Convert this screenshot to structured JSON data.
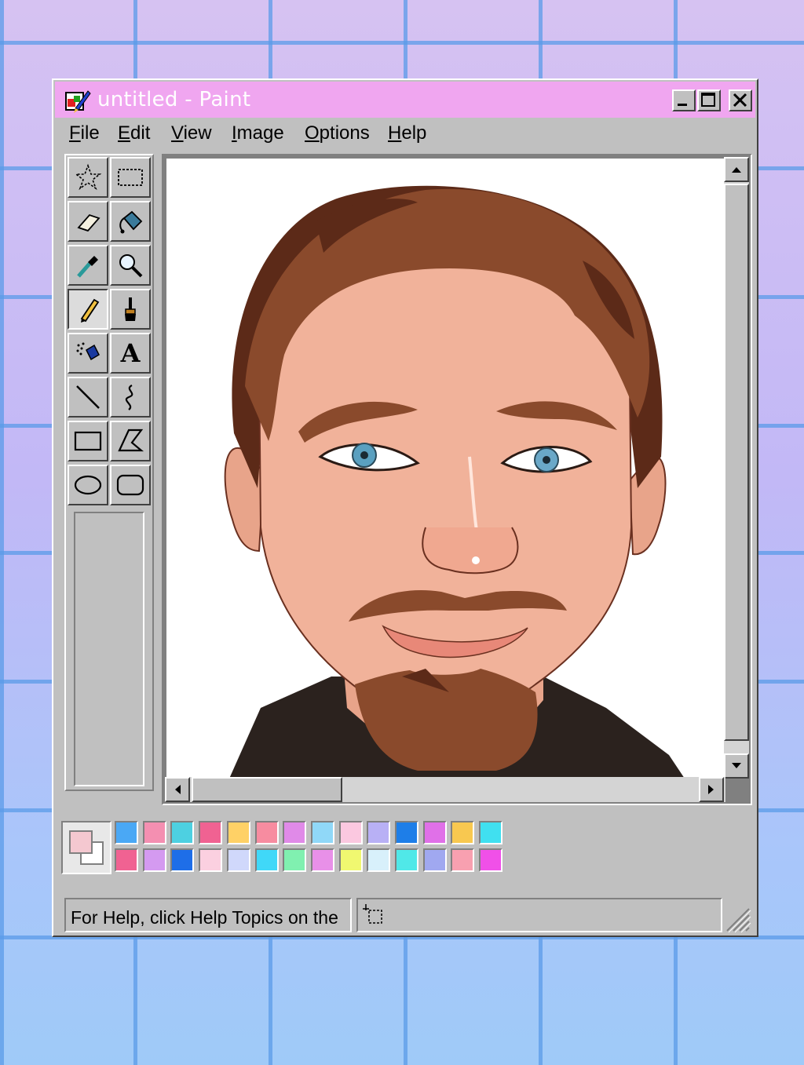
{
  "window": {
    "title": "untitled - Paint",
    "controls": [
      "minimize",
      "maximize",
      "close"
    ]
  },
  "menu": [
    {
      "label": "File",
      "accel": "F",
      "rest": "ile"
    },
    {
      "label": "Edit",
      "accel": "E",
      "rest": "dit"
    },
    {
      "label": "View",
      "accel": "V",
      "rest": "iew"
    },
    {
      "label": "Image",
      "accel": "I",
      "rest": "mage"
    },
    {
      "label": "Options",
      "accel": "O",
      "rest": "ptions"
    },
    {
      "label": "Help",
      "accel": "H",
      "rest": "elp"
    }
  ],
  "tools": [
    {
      "name": "free-form-select",
      "icon": "star-select-icon"
    },
    {
      "name": "rect-select",
      "icon": "dashed-rect-icon"
    },
    {
      "name": "eraser",
      "icon": "eraser-icon"
    },
    {
      "name": "fill",
      "icon": "paint-bucket-icon"
    },
    {
      "name": "pick-color",
      "icon": "eyedropper-icon"
    },
    {
      "name": "magnifier",
      "icon": "magnifier-icon"
    },
    {
      "name": "pencil",
      "icon": "pencil-icon",
      "active": true
    },
    {
      "name": "brush",
      "icon": "brush-icon"
    },
    {
      "name": "airbrush",
      "icon": "airbrush-icon"
    },
    {
      "name": "text",
      "icon": "text-icon",
      "glyph": "A"
    },
    {
      "name": "line",
      "icon": "line-icon"
    },
    {
      "name": "curve",
      "icon": "curve-icon"
    },
    {
      "name": "rectangle",
      "icon": "rectangle-icon"
    },
    {
      "name": "polygon",
      "icon": "polygon-icon"
    },
    {
      "name": "ellipse",
      "icon": "ellipse-icon"
    },
    {
      "name": "rounded-rect",
      "icon": "rounded-rect-icon"
    }
  ],
  "colors": {
    "foreground": "#f4c8d0",
    "background": "#ffffff",
    "palette_row1": [
      "#4aa8f5",
      "#f48fb1",
      "#4dd0e1",
      "#f06292",
      "#ffd166",
      "#f78ca0",
      "#e08ae8",
      "#90d8f8",
      "#fbc8e0",
      "#b8b0f5",
      "#1e7ee8",
      "#e070e8",
      "#f8c850",
      "#40e0f0"
    ],
    "palette_row2": [
      "#f06292",
      "#d49af0",
      "#1e6ee8",
      "#fbd0e0",
      "#d0d8fb",
      "#40d8f8",
      "#80f0b0",
      "#e890e8",
      "#f0f870",
      "#d8f0fb",
      "#50e8e8",
      "#a0a8f0",
      "#f8a0b0",
      "#f050e8"
    ]
  },
  "status": {
    "help_text": "For Help, click Help Topics on the"
  },
  "canvas": {
    "content": "cartoon portrait"
  }
}
